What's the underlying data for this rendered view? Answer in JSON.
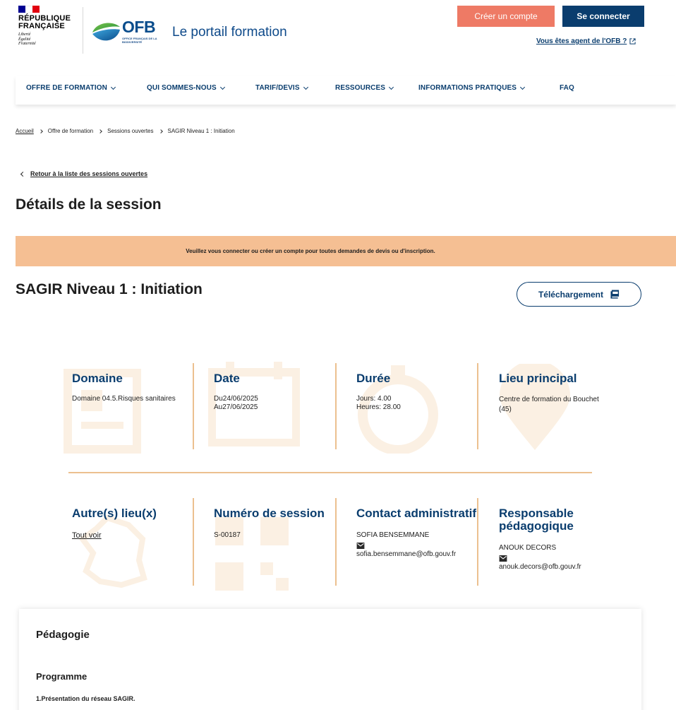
{
  "header": {
    "republique": "RÉPUBLIQUE",
    "francaise": "FRANÇAISE",
    "devise": [
      "Liberté",
      "Égalité",
      "Fraternité"
    ],
    "ofb_word": "OFB",
    "ofb_sub": "OFFICE FRANÇAIS DE LA BIODIVERSITÉ",
    "portal_title": "Le portail formation",
    "create_account": "Créer un compte",
    "login": "Se connecter",
    "agent_link": "Vous êtes agent de l'OFB ?",
    "flag_colors": [
      "#000091",
      "#ffffff",
      "#e1000f"
    ]
  },
  "nav": {
    "items": [
      {
        "label": "OFFRE DE FORMATION"
      },
      {
        "label": "QUI SOMMES-NOUS"
      },
      {
        "label": "TARIF/DEVIS"
      },
      {
        "label": "RESSOURCES"
      },
      {
        "label": "INFORMATIONS PRATIQUES"
      },
      {
        "label": "FAQ"
      }
    ]
  },
  "breadcrumb": [
    "Accueil",
    "Offre de formation",
    "Sessions ouvertes",
    "SAGIR Niveau 1 : Initiation"
  ],
  "back_link": "Retour à la liste des sessions ouvertes",
  "page_title": "Détails de la session",
  "banner": "Veuillez vous connecter ou créer un compte pour toutes demandes de devis ou d'inscription.",
  "session": {
    "title": "SAGIR Niveau 1 : Initiation",
    "download": "Téléchargement"
  },
  "info": {
    "domaine": {
      "title": "Domaine",
      "value": "Domaine 04.5.Risques sanitaires"
    },
    "date": {
      "title": "Date",
      "line1": "Du24/06/2025",
      "line2": "Au27/06/2025"
    },
    "duree": {
      "title": "Durée",
      "line1": "Jours: 4.00",
      "line2": "Heures: 28.00"
    },
    "lieu": {
      "title": "Lieu principal",
      "value": "Centre de formation du Bouchet (45)"
    },
    "autres": {
      "title": "Autre(s) lieu(x)",
      "link": "Tout voir"
    },
    "numero": {
      "title": "Numéro de session",
      "value": "S-00187"
    },
    "contact": {
      "title": "Contact administratif",
      "name": "SOFIA BENSEMMANE",
      "email": "sofia.bensemmane@ofb.gouv.fr"
    },
    "responsable": {
      "title": "Responsable pédagogique",
      "name": "ANOUK DECORS",
      "email": "anouk.decors@ofb.gouv.fr"
    }
  },
  "pedagogie": {
    "title": "Pédagogie",
    "programme": "Programme",
    "item1": "1.Présentation du réseau SAGIR."
  },
  "colors": {
    "primary": "#0a3d6e",
    "accent": "#ee7a65",
    "banner": "#f5bf93",
    "divider": "#ecc08f"
  }
}
